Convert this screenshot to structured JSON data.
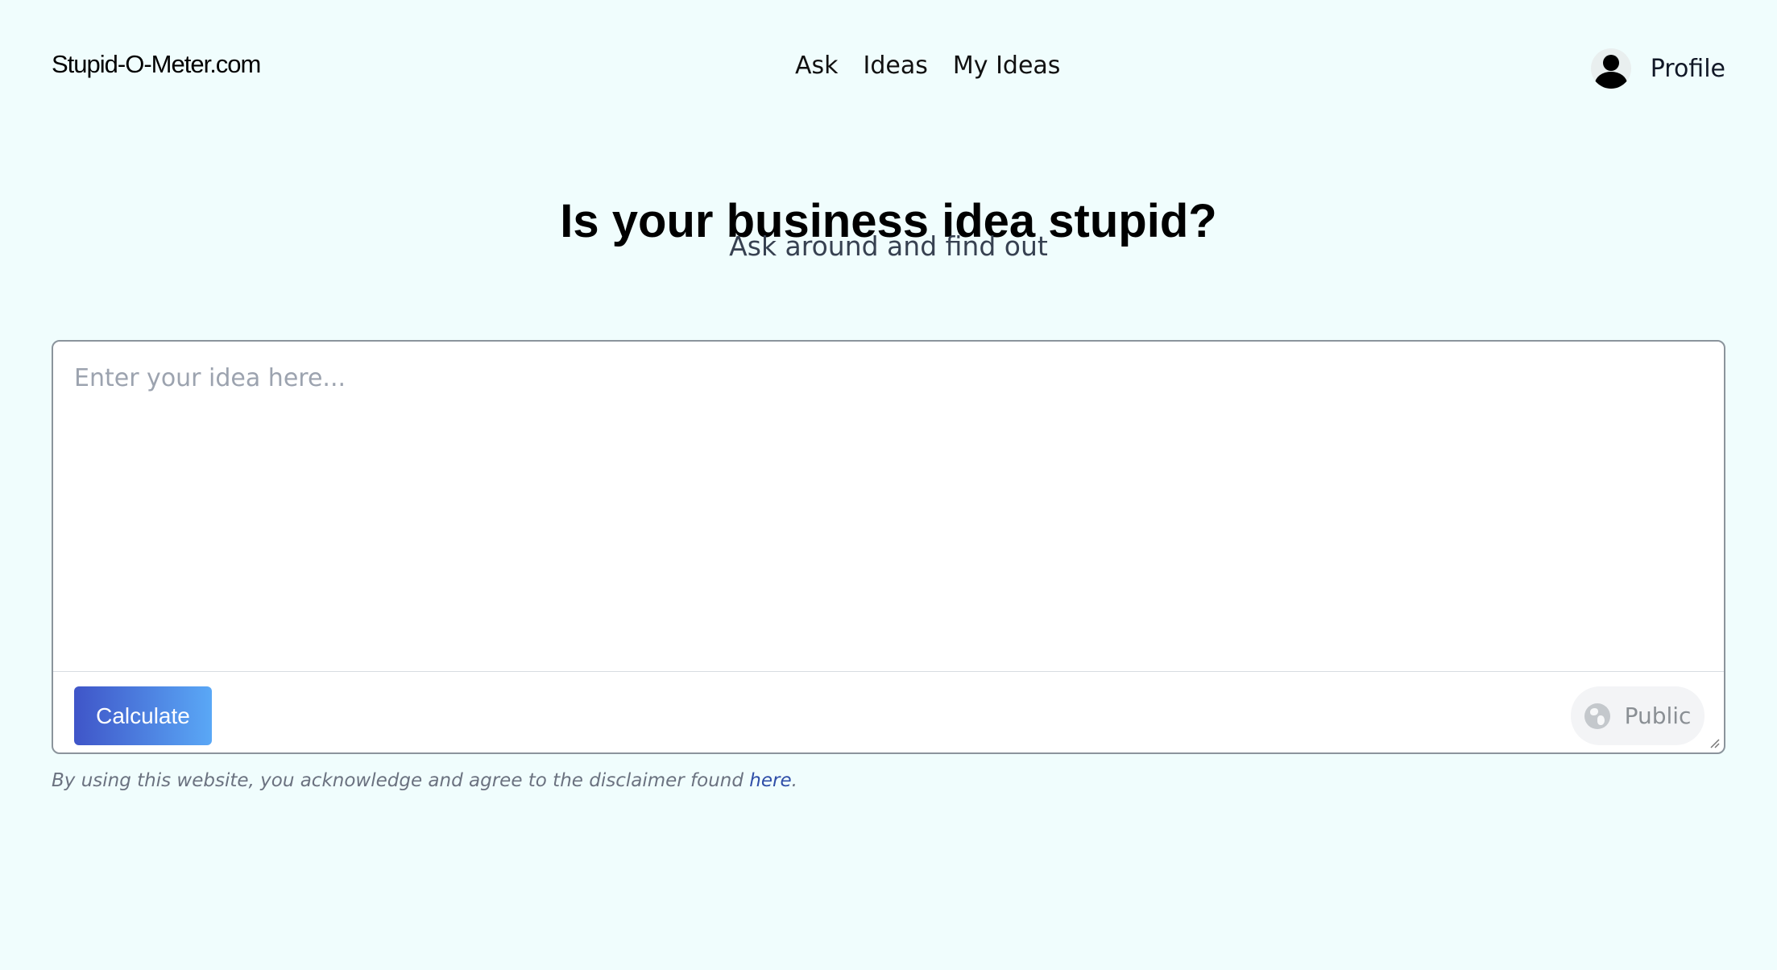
{
  "header": {
    "brand": "Stupid-O-Meter.com",
    "nav": [
      {
        "label": "Ask"
      },
      {
        "label": "Ideas"
      },
      {
        "label": "My Ideas"
      }
    ],
    "profile_label": "Profile",
    "profile_icon": "user-icon"
  },
  "hero": {
    "title": "Is your business idea stupid?",
    "subtitle": "Ask around and find out"
  },
  "form": {
    "idea_value": "",
    "idea_placeholder": "Enter your idea here...",
    "calculate_label": "Calculate",
    "visibility_label": "Public",
    "visibility_icon": "globe-icon",
    "resize_icon": "resize-handle-icon"
  },
  "disclaimer": {
    "prefix": "By using this website, you acknowledge and agree to the disclaimer found ",
    "link_text": "here",
    "suffix": "."
  },
  "colors": {
    "background": "#f0fdfd",
    "button_gradient_start": "#3f55c8",
    "button_gradient_end": "#5aa8f6",
    "link": "#2f4ea8"
  }
}
